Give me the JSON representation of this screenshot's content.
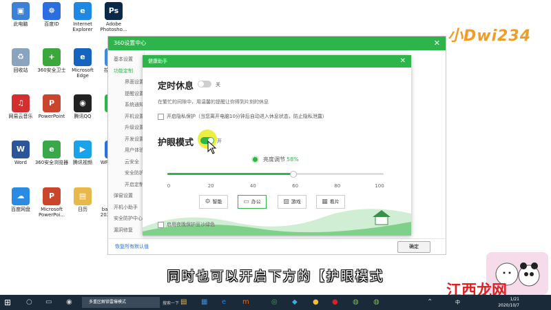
{
  "desktop": {
    "icons": [
      {
        "label": "此电脑",
        "icon": "computer-icon",
        "color": "#3b82d6",
        "glyph": "▣"
      },
      {
        "label": "百度ID",
        "icon": "baidu-icon",
        "color": "#2b6ee0",
        "glyph": "☸"
      },
      {
        "label": "Internet\nExplorer",
        "icon": "internet-explorer-icon",
        "color": "#1e88e5",
        "glyph": "e"
      },
      {
        "label": "Adobe\nPhotosho...",
        "icon": "photoshop-icon",
        "color": "#0b2a4a",
        "glyph": "Ps"
      },
      {
        "label": "回收站",
        "icon": "recycle-bin-icon",
        "color": "#8aa4bf",
        "glyph": "♻"
      },
      {
        "label": "360安全卫士",
        "icon": "360-safe-icon",
        "color": "#3ca83c",
        "glyph": "+"
      },
      {
        "label": "Microsoft\nEdge",
        "icon": "edge-icon",
        "color": "#1565c0",
        "glyph": "e"
      },
      {
        "label": "控制面板",
        "icon": "control-panel-icon",
        "color": "#3a8dd6",
        "glyph": "◧"
      },
      {
        "label": "网易云音乐",
        "icon": "netease-music-icon",
        "color": "#d32f2f",
        "glyph": "♫"
      },
      {
        "label": "PowerPoint",
        "icon": "powerpoint-icon",
        "color": "#c9452b",
        "glyph": "P"
      },
      {
        "label": "腾讯QQ",
        "icon": "qq-icon",
        "color": "#222222",
        "glyph": "◉"
      },
      {
        "label": "微信",
        "icon": "wechat-icon",
        "color": "#2db44a",
        "glyph": "✉"
      },
      {
        "label": "Word",
        "icon": "word-icon",
        "color": "#2b579a",
        "glyph": "W"
      },
      {
        "label": "360安全浏览器",
        "icon": "360-browser-icon",
        "color": "#3aa84a",
        "glyph": "e"
      },
      {
        "label": "腾讯视频",
        "icon": "tencent-video-icon",
        "color": "#1aa3e8",
        "glyph": "▶"
      },
      {
        "label": "WPS Office",
        "icon": "wps-icon",
        "color": "#2a72d8",
        "glyph": "W"
      },
      {
        "label": "百度网盘",
        "icon": "baidu-pan-icon",
        "color": "#2b8be0",
        "glyph": "☁"
      },
      {
        "label": "Microsoft\nPowerPoi...",
        "icon": "powerpoint-file-icon",
        "color": "#c9452b",
        "glyph": "P"
      },
      {
        "label": "日历",
        "icon": "folder-icon",
        "color": "#e8b84a",
        "glyph": "▤"
      },
      {
        "label": "bandicam\n2020-10-...",
        "icon": "bandicam-icon",
        "color": "#ffffff",
        "glyph": ""
      }
    ],
    "logo_text": "小Dwi234"
  },
  "settings_window": {
    "title": "360设置中心",
    "sidebar": [
      "基本设置",
      "功能定制",
      "界面设置",
      "提醒设置",
      "系统通知",
      "开机设置",
      "升级设置",
      "开发设置",
      "用户体验",
      "云安全",
      "安全防护",
      "开启定制",
      "弹窗设置",
      "开机小助手",
      "安全防护中心",
      "漏洞修复"
    ],
    "restore_label": "恢复所有默认值",
    "ok_label": "确定"
  },
  "health_dialog": {
    "title": "健康助手",
    "timed_rest": {
      "title": "定时休息",
      "state": "关",
      "enabled": false,
      "description": "在繁忙的间隙中，用温馨的提醒让你得到片刻的休息"
    },
    "privacy_checkbox": "开启隐私保护（当您离开电脑10分钟后自动进入休息状态，防止隐私泄露）",
    "eye_mode": {
      "title": "护眼模式",
      "state": "开",
      "enabled": true
    },
    "brightness": {
      "label": "亮度调节",
      "value_text": "58%",
      "value": 58
    },
    "ticks": [
      "0",
      "20",
      "40",
      "60",
      "80",
      "100"
    ],
    "modes": [
      {
        "label": "智能",
        "icon": "gear-icon",
        "glyph": "⚙"
      },
      {
        "label": "办公",
        "icon": "monitor-icon",
        "glyph": "▭"
      },
      {
        "label": "游戏",
        "icon": "image-icon",
        "glyph": "▨"
      },
      {
        "label": "看片",
        "icon": "film-icon",
        "glyph": "▦"
      }
    ],
    "bottom_option": "启用夜晚保护豆沙绿色"
  },
  "subtitle": "同时也可以开启下方的【护眼模式",
  "watermark": "江西龙网",
  "taskbar": {
    "task_label": "多重区解锁雷爆模式",
    "search_label": "搜索一下",
    "lang": "中",
    "time": "1/21",
    "date": "2020/10/7"
  },
  "colors": {
    "accent": "#2db44a",
    "taskbar": "#1b2a38"
  }
}
